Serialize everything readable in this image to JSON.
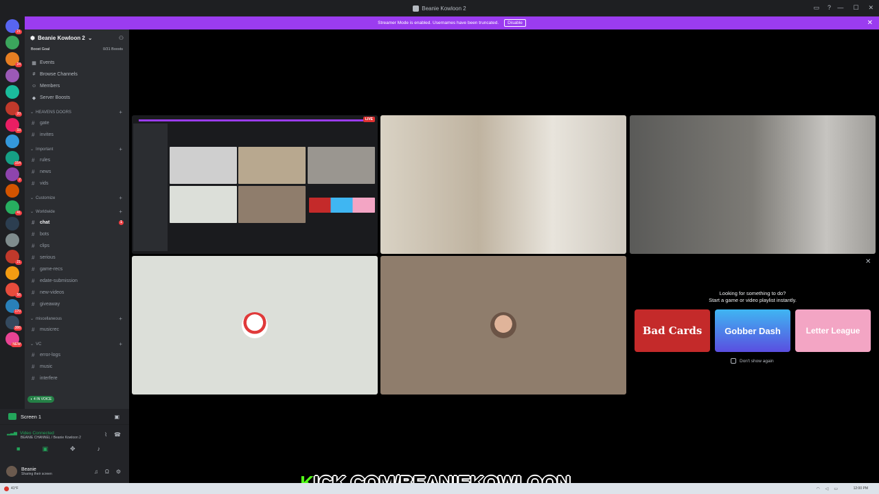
{
  "window": {
    "title": "Beanie Kowloon 2",
    "controls": [
      "—",
      "☐",
      "✕"
    ],
    "toolbar_icons": [
      "inbox-icon",
      "help-icon"
    ]
  },
  "banner": {
    "text": "Streamer Mode is enabled. Usernames have been truncated.",
    "disable_label": "Disable",
    "close": "✕"
  },
  "rail": {
    "servers": [
      {
        "color": "#5865f2",
        "ping": "21"
      },
      {
        "color": "#3ba55c",
        "ping": ""
      },
      {
        "color": "#e67e22",
        "ping": "24"
      },
      {
        "color": "#9b59b6",
        "ping": ""
      },
      {
        "color": "#1abc9c",
        "ping": ""
      },
      {
        "color": "#c0392b",
        "ping": "20"
      },
      {
        "color": "#e91e63",
        "ping": "33"
      },
      {
        "color": "#3498db",
        "ping": ""
      },
      {
        "color": "#16a085",
        "ping": "154"
      },
      {
        "color": "#8e44ad",
        "ping": "2"
      },
      {
        "color": "#d35400",
        "ping": ""
      },
      {
        "color": "#27ae60",
        "ping": "41"
      },
      {
        "color": "#2c3e50",
        "ping": ""
      },
      {
        "color": "#7f8c8d",
        "ping": ""
      },
      {
        "color": "#c0392b",
        "ping": "21"
      },
      {
        "color": "#f39c12",
        "ping": ""
      },
      {
        "color": "#e74c3c",
        "ping": "56"
      },
      {
        "color": "#2980b9",
        "ping": "170"
      },
      {
        "color": "#34495e",
        "ping": "386"
      },
      {
        "color": "#e84393",
        "ping": "NEW"
      }
    ]
  },
  "sidebar": {
    "server_name": "Beanie Kowloon 2",
    "boost_goal": "Boost Goal",
    "boost_count": "0/31 Boosts",
    "menu": [
      {
        "icon": "▦",
        "label": "Events"
      },
      {
        "icon": "#",
        "label": "Browse Channels"
      },
      {
        "icon": "☺",
        "label": "Members"
      },
      {
        "icon": "◆",
        "label": "Server Boosts"
      }
    ],
    "categories": [
      {
        "label": "HEAVENS DOORS",
        "channels": [
          {
            "label": "gate",
            "active": false
          },
          {
            "label": "invites",
            "active": false
          }
        ]
      },
      {
        "label": "Important",
        "channels": [
          {
            "label": "rules",
            "active": false
          },
          {
            "label": "news",
            "active": false
          },
          {
            "label": "vids",
            "active": false
          }
        ]
      },
      {
        "label": "Customize",
        "channels": []
      },
      {
        "label": "Worldwide",
        "channels": [
          {
            "label": "chat",
            "active": true
          },
          {
            "label": "bots",
            "active": false
          },
          {
            "label": "clips",
            "active": false
          },
          {
            "label": "serious",
            "active": false
          },
          {
            "label": "game-recs",
            "active": false
          },
          {
            "label": "edate-submission",
            "active": false
          },
          {
            "label": "new-videos",
            "active": false
          },
          {
            "label": "giveaway",
            "active": false
          }
        ]
      },
      {
        "label": "miscellaneous",
        "channels": [
          {
            "label": "musicrec",
            "active": false
          }
        ]
      },
      {
        "label": "VC",
        "channels": [
          {
            "label": "error-logs",
            "active": false
          },
          {
            "label": "music",
            "active": false
          },
          {
            "label": "interfere",
            "active": false
          }
        ]
      }
    ],
    "voice_pill": "4 IN VOICE"
  },
  "screen_panel": {
    "label": "Screen 1"
  },
  "voice_panel": {
    "status": "Video Connected",
    "location": "BEANIE CHANNEL / Beanie Kowloon 2"
  },
  "user_panel": {
    "name": "Beanie",
    "status": "Sharing their screen"
  },
  "activity": {
    "title_line1": "Looking for something to do?",
    "title_line2": "Start a game or video playlist instantly.",
    "games": [
      "Bad Cards",
      "Gobber Dash",
      "Letter League"
    ],
    "dont_show_label": "Don't show again"
  },
  "overlay": {
    "kick_k": "K",
    "kick_text": "ICK.COM/BEANIEKOWLOON"
  },
  "taskbar": {
    "weather": "41°F",
    "time": "12:00 PM"
  },
  "colors": {
    "accent": "#9b3cf0",
    "online": "#23a55a",
    "kick_green": "#53fc18"
  }
}
